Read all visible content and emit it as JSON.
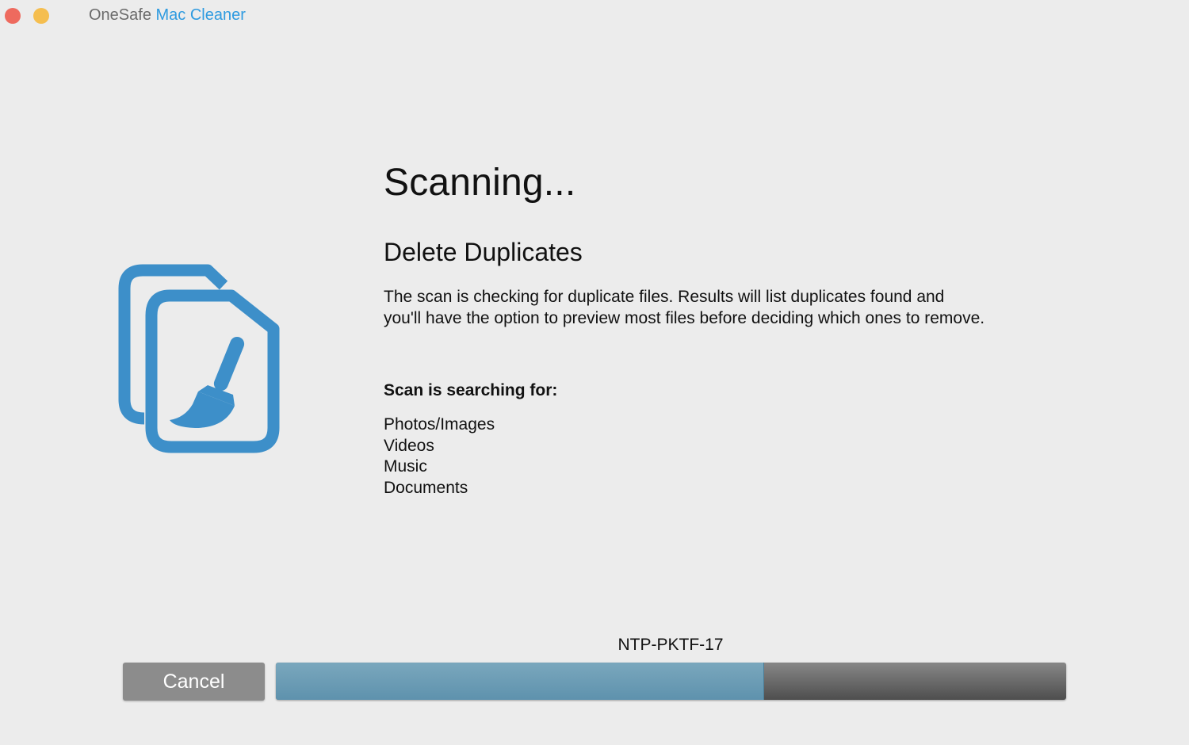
{
  "window": {
    "title_prefix": "OneSafe",
    "title_accent": "Mac Cleaner",
    "accent_color": "#2f9be0",
    "controls": [
      "close",
      "minimize"
    ]
  },
  "icon": {
    "name": "duplicate-files-broom-icon",
    "color": "#3d8fc9"
  },
  "main": {
    "heading": "Scanning...",
    "subheading": "Delete Duplicates",
    "description": "The scan is checking for duplicate files.   Results will list duplicates found and you'll have the option to preview most files before deciding which ones to remove.",
    "searching_label": "Scan is searching for:",
    "search_items": [
      "Photos/Images",
      "Videos",
      "Music",
      "Documents"
    ]
  },
  "footer": {
    "current_item": "NTP-PKTF-17",
    "cancel_label": "Cancel",
    "progress_fraction": 0.617
  }
}
